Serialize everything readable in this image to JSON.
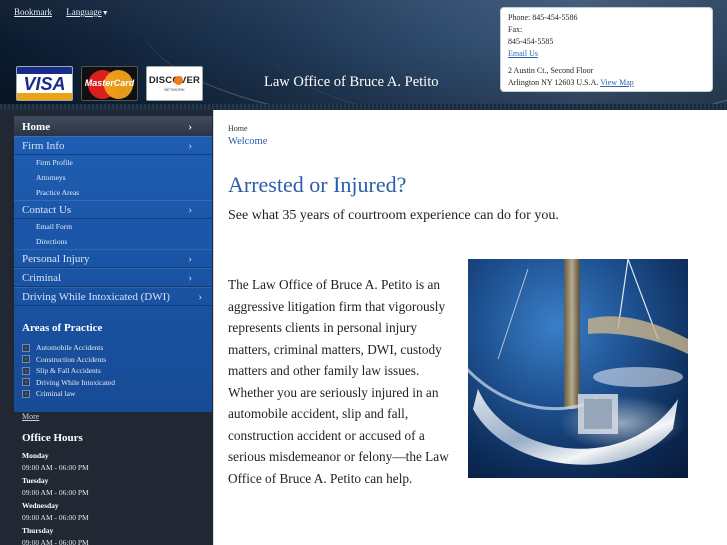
{
  "header": {
    "bookmark_label": "Bookmark",
    "language_label": "Language",
    "site_title": "Law Office of Bruce A. Petito",
    "cards": {
      "visa": "VISA",
      "mastercard": "MasterCard",
      "discover": "DISCOVER",
      "discover_sub": "NETWORK"
    },
    "contact": {
      "phone": "Phone: 845-454-5586",
      "fax_label": "Fax:",
      "fax": "845-454-5585",
      "email_link": "Email Us",
      "address1": "2 Austin Ct., Second Floor",
      "address2": "Arlington NY 12603 U.S.A.",
      "map_link": "View Map"
    }
  },
  "sidebar": {
    "nav": {
      "home": "Home",
      "firm_info": "Firm Info",
      "firm_profile": "Firm Profile",
      "attorneys": "Attorneys",
      "practice_areas": "Practice Areas",
      "contact_us": "Contact Us",
      "email_form": "Email Form",
      "directions": "Directions",
      "personal_injury": "Personal Injury",
      "criminal": "Criminal",
      "dwi": "Driving While Intoxicated (DWI)",
      "chevron": "›"
    },
    "areas_title": "Areas of Practice",
    "areas": [
      "Automobile Accidents",
      "Construction Accidents",
      "Slip & Fall Accidents",
      "Driving While Intoxicated",
      "Criminal law"
    ],
    "more_link": "More",
    "hours_title": "Office Hours",
    "hours": [
      {
        "day": "Monday",
        "time": "09:00 AM - 06:00 PM"
      },
      {
        "day": "Tuesday",
        "time": "09:00 AM - 06:00 PM"
      },
      {
        "day": "Wednesday",
        "time": "09:00 AM - 06:00 PM"
      },
      {
        "day": "Thursday",
        "time": "09:00 AM - 06:00 PM"
      }
    ]
  },
  "main": {
    "breadcrumb": "Home",
    "current_page": "Welcome",
    "headline": "Arrested or Injured?",
    "tagline": "See what 35 years of courtroom experience can do for you.",
    "body": "The Law Office of Bruce A. Petito is an aggressive litigation firm that vigorously represents clients in personal injury matters, criminal matters, DWI, custody matters and other family law issues.  Whether you are seriously injured in an automobile accident, slip and fall, construction accident or accused of a serious misdemeanor or felony—the Law Office of Bruce A. Petito can help."
  }
}
